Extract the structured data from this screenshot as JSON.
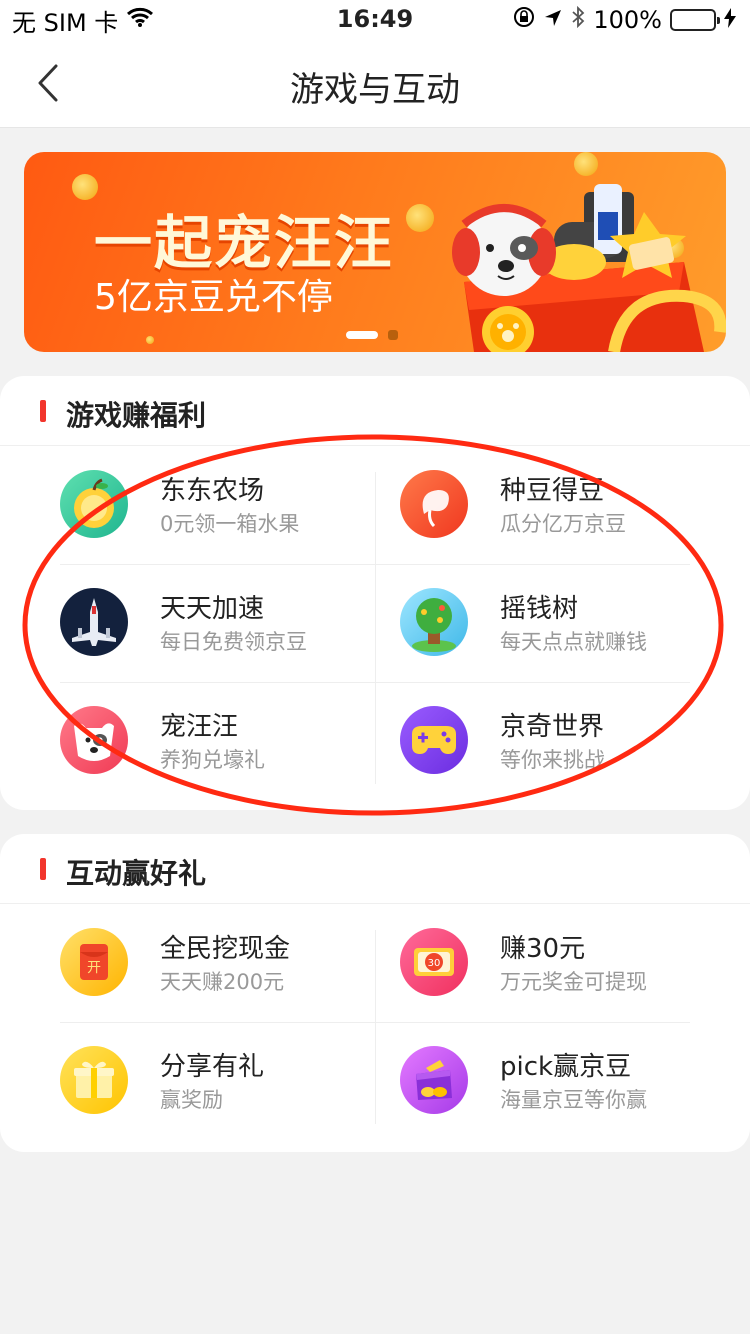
{
  "status_bar": {
    "carrier": "无 SIM 卡",
    "time": "16:49",
    "battery": "100%",
    "battery_level": 1.0
  },
  "nav": {
    "title": "游戏与互动",
    "back_icon": "chevron-left-icon"
  },
  "banner": {
    "title": "一起宠汪汪",
    "subtitle": "5亿京豆兑不停",
    "slide_count": 2,
    "active_slide": 1
  },
  "games_section": {
    "title": "游戏赚福利",
    "items": [
      {
        "name": "东东农场",
        "desc": "0元领一箱水果",
        "icon": "apple-icon"
      },
      {
        "name": "种豆得豆",
        "desc": "瓜分亿万京豆",
        "icon": "bean-sprout-icon"
      },
      {
        "name": "天天加速",
        "desc": "每日免费领京豆",
        "icon": "plane-icon"
      },
      {
        "name": "摇钱树",
        "desc": "每天点点就赚钱",
        "icon": "money-tree-icon"
      },
      {
        "name": "宠汪汪",
        "desc": "养狗兑壕礼",
        "icon": "dog-icon"
      },
      {
        "name": "京奇世界",
        "desc": "等你来挑战",
        "icon": "gamepad-icon"
      }
    ]
  },
  "interact_section": {
    "title": "互动赢好礼",
    "items": [
      {
        "name": "全民挖现金",
        "desc": "天天赚200元",
        "icon": "red-envelope-icon",
        "badge": "开"
      },
      {
        "name": "赚30元",
        "desc": "万元奖金可提现",
        "icon": "coupon-icon",
        "badge": "30"
      },
      {
        "name": "分享有礼",
        "desc": "赢奖励",
        "icon": "gift-icon"
      },
      {
        "name": "pick赢京豆",
        "desc": "海量京豆等你赢",
        "icon": "gift-box-icon"
      }
    ]
  },
  "colors": {
    "accent": "#f2352c",
    "annotation": "#ff2a12",
    "banner_orange": "#ff6a16"
  }
}
